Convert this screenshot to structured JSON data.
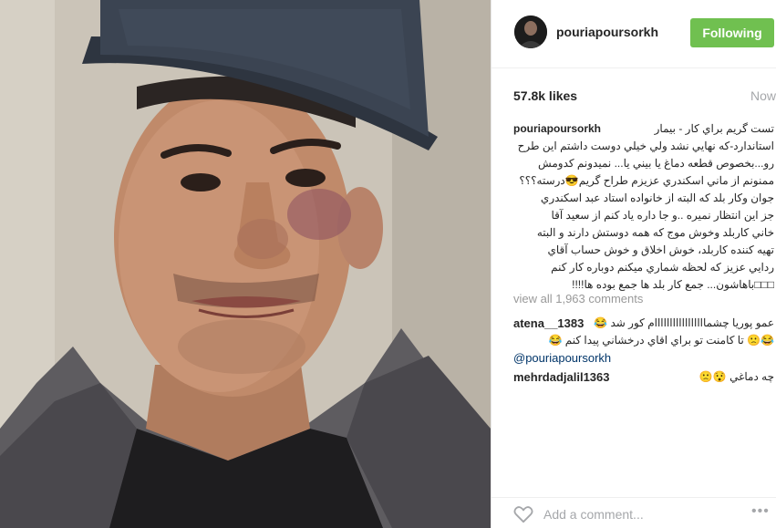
{
  "post": {
    "username": "pouriapoursorkh",
    "follow_label": "Following",
    "likes": "57.8k likes",
    "time": "Now",
    "caption": "تست گريم براي كار - بيمار\nاستاندارد-كه نهايي نشد ولي خيلي دوست داشتم اين طرح\nرو...بخصوص قطعه دماغ يا بيني يا... نميدونم كدومش\nممنونم از ماني اسكندري عزيزم طراح گريم😎درسته؟؟؟\nجوان وكار بلد كه البته از خانواده استاد عبد اسكندري\nجز اين انتظار نميره ..و جا داره ياد كنم از سعيد آقا\nخاني كاربلد وخوش موج كه همه دوستش دارند و البته\nتهيه كننده كاربلد، خوش اخلاق و خوش حساب آقاي\nردايي عزيز كه لحظه شماري ميكنم دوباره كار كنم\n□□□باهاشون... جمع كار بلد ها جمع بوده ها!!!!",
    "view_all": "view all 1,963 comments",
    "comments": [
      {
        "user": "atena__1383",
        "text": "عمو پوريا چشمااااااااااااااااام كور شد 😂😂🙁 تا كامنت تو براي اقاي درخشاني پيدا كنم 😂",
        "mention": "@pouriapoursorkh"
      },
      {
        "user": "mehrdadjalil1363",
        "text": "چه دماغي 😯🙁"
      }
    ],
    "add_comment_placeholder": "Add a comment...",
    "more_label": "•••"
  },
  "icons": {
    "avatar": "profile-avatar",
    "like": "heart-icon",
    "more": "more-options-icon"
  },
  "colors": {
    "follow_button": "#70c050",
    "muted_text": "#a5a7aa",
    "mention": "#003569"
  }
}
